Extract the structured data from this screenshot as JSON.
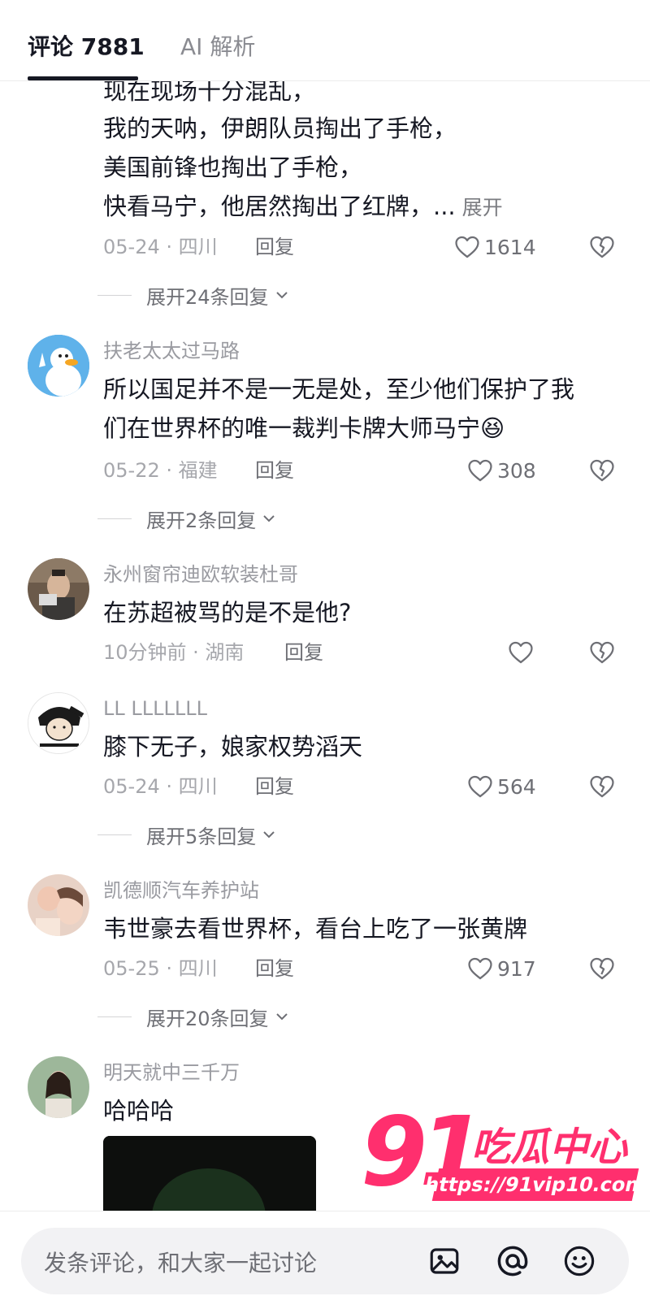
{
  "tabs": {
    "comments_label": "评论 7881",
    "ai_label": "AI 解析"
  },
  "comment0": {
    "lines": [
      "现在现场十分混乱，",
      "我的天呐，伊朗队员掏出了手枪，",
      "美国前锋也掏出了手枪，",
      "快看马宁，他居然掏出了红牌，..."
    ],
    "expand_label": "展开",
    "meta": "05-24 · 四川",
    "reply": "回复",
    "likes": "1614",
    "replies_label": "展开24条回复"
  },
  "comments": [
    {
      "user": "扶老太太过马路",
      "text_line1": "所以国足并不是一无是处，至少他们保护了我",
      "text_line2": "们在世界杯的唯一裁判卡牌大师马宁",
      "emoji": "😆",
      "meta": "05-22 · 福建",
      "reply": "回复",
      "likes": "308",
      "replies_label": "展开2条回复"
    },
    {
      "user": "永州窗帘迪欧软装杜哥",
      "text_line1": "在苏超被骂的是不是他?",
      "meta": "10分钟前 · 湖南",
      "reply": "回复"
    },
    {
      "user": "LL LLLLLLL",
      "text_line1": "膝下无子，娘家权势滔天",
      "meta": "05-24 · 四川",
      "reply": "回复",
      "likes": "564",
      "replies_label": "展开5条回复"
    },
    {
      "user": "凯德顺汽车养护站",
      "text_line1": "韦世豪去看世界杯，看台上吃了一张黄牌",
      "meta": "05-25 · 四川",
      "reply": "回复",
      "likes": "917",
      "replies_label": "展开20条回复"
    },
    {
      "user": "明天就中三千万",
      "text_line1": "哈哈哈"
    }
  ],
  "watermark": {
    "number": "91",
    "cn_text": "吃瓜中心",
    "url": "https://91vip10.com"
  },
  "bottom_bar": {
    "placeholder": "发条评论，和大家一起讨论"
  },
  "colors": {
    "accent_watermark": "#ff2f6e",
    "text_primary": "#161823",
    "text_secondary": "#9a9ba1"
  }
}
